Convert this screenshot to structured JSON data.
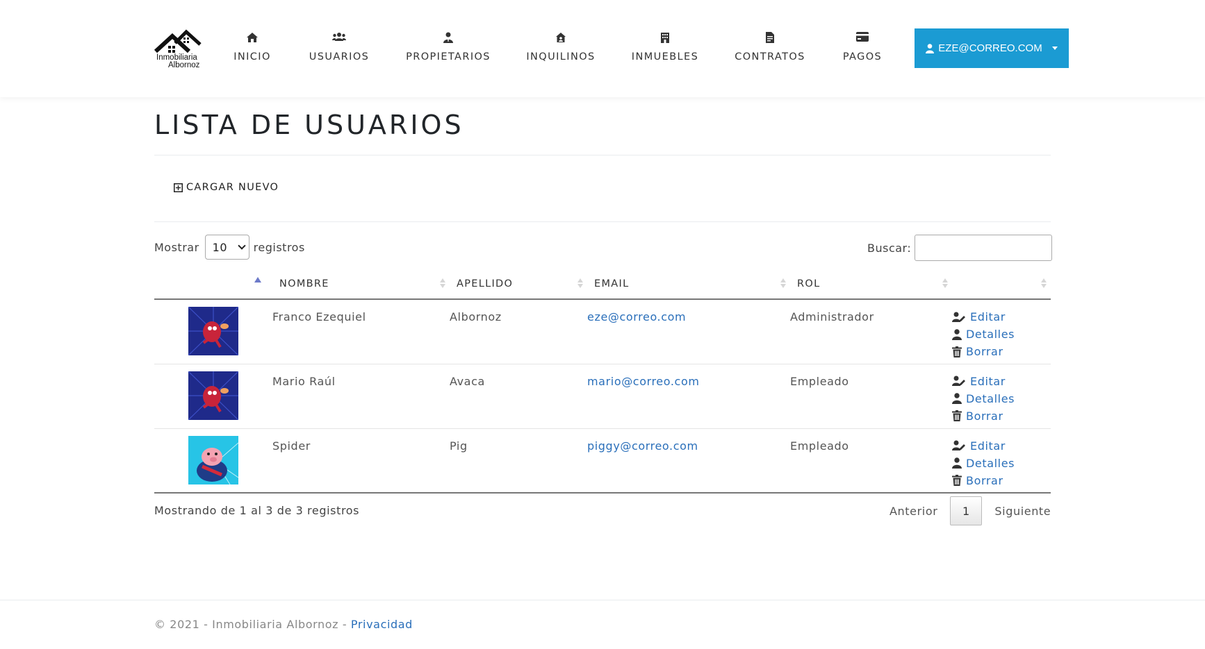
{
  "brand": {
    "logo_text_line1": "Inmobiliaria",
    "logo_text_line2": "Albornoz"
  },
  "nav": {
    "items": [
      {
        "label": "INICIO",
        "icon": "home-icon"
      },
      {
        "label": "USUARIOS",
        "icon": "users-icon"
      },
      {
        "label": "PROPIETARIOS",
        "icon": "user-tie-icon"
      },
      {
        "label": "INQUILINOS",
        "icon": "house-user-icon"
      },
      {
        "label": "INMUEBLES",
        "icon": "building-icon"
      },
      {
        "label": "CONTRATOS",
        "icon": "file-contract-icon"
      },
      {
        "label": "PAGOS",
        "icon": "credit-card-icon"
      }
    ],
    "user_menu_label": "EZE@CORREO.COM"
  },
  "colors": {
    "accent": "#1b9bd3",
    "link": "#2a6fba",
    "sort_active": "#6c7ac9"
  },
  "page": {
    "title": "LISTA DE USUARIOS",
    "new_button": "CARGAR NUEVO"
  },
  "table_controls": {
    "show_label": "Mostrar",
    "page_size": "10",
    "records_label": "registros",
    "search_label": "Buscar:",
    "search_value": ""
  },
  "table": {
    "columns": [
      "",
      "NOMBRE",
      "APELLIDO",
      "EMAIL",
      "ROL",
      ""
    ],
    "rows": [
      {
        "avatar": "spider-ham-avatar",
        "nombre": "Franco Ezequiel",
        "apellido": "Albornoz",
        "email": "eze@correo.com",
        "rol": "Administrador"
      },
      {
        "avatar": "spider-ham-avatar",
        "nombre": "Mario Raúl",
        "apellido": "Avaca",
        "email": "mario@correo.com",
        "rol": "Empleado"
      },
      {
        "avatar": "pig-avatar",
        "nombre": "Spider",
        "apellido": "Pig",
        "email": "piggy@correo.com",
        "rol": "Empleado"
      }
    ],
    "actions": {
      "edit": "Editar",
      "details": "Detalles",
      "delete": "Borrar"
    }
  },
  "pagination": {
    "info": "Mostrando de 1 al 3 de 3 registros",
    "previous": "Anterior",
    "current_page": "1",
    "next": "Siguiente"
  },
  "footer": {
    "copyright": "© 2021 - Inmobiliaria Albornoz - ",
    "privacy_link": "Privacidad"
  }
}
